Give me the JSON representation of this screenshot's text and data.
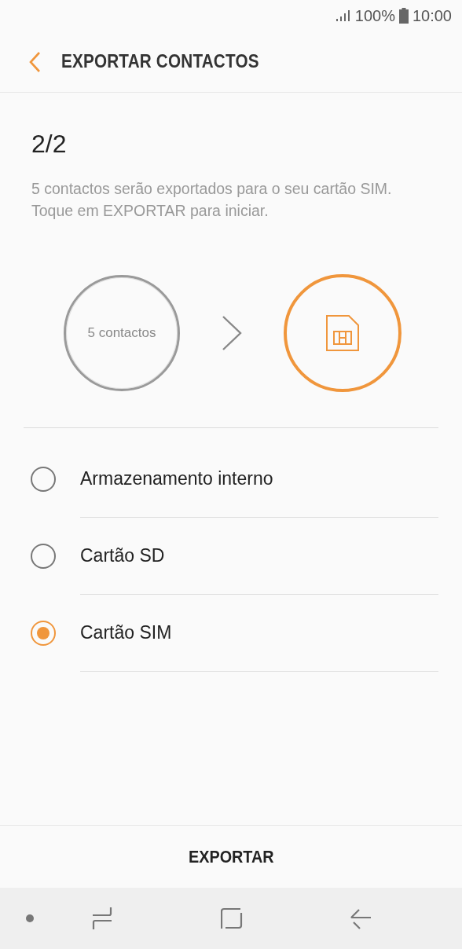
{
  "status_bar": {
    "battery": "100%",
    "time": "10:00"
  },
  "header": {
    "title": "EXPORTAR CONTACTOS"
  },
  "step": "2/2",
  "description": "5 contactos serão exportados para o seu cartão SIM. Toque em EXPORTAR para iniciar.",
  "transfer": {
    "source": "5 contactos"
  },
  "options": [
    {
      "label": "Armazenamento interno",
      "selected": false
    },
    {
      "label": "Cartão SD",
      "selected": false
    },
    {
      "label": "Cartão SIM",
      "selected": true
    }
  ],
  "action": "EXPORTAR"
}
